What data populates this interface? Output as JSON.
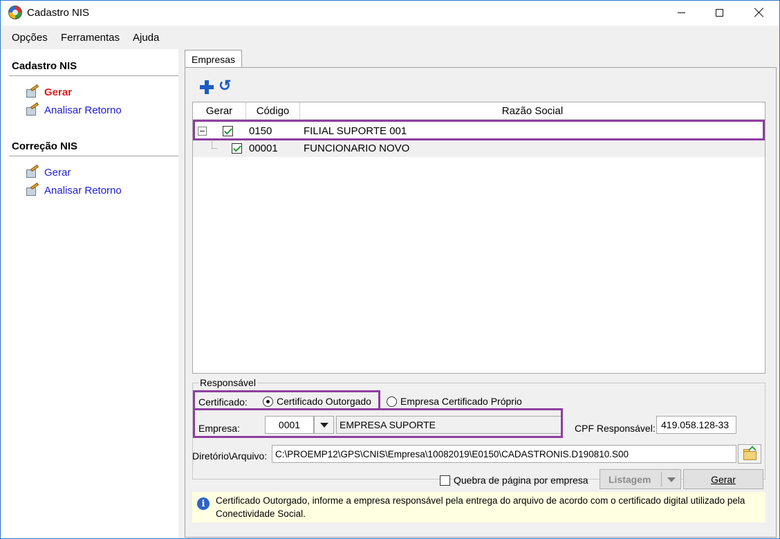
{
  "window": {
    "title": "Cadastro NIS"
  },
  "menu": {
    "items": [
      "Opções",
      "Ferramentas",
      "Ajuda"
    ]
  },
  "sidebar": {
    "sections": [
      {
        "title": "Cadastro NIS",
        "links": [
          {
            "label": "Gerar",
            "active": true
          },
          {
            "label": "Analisar Retorno",
            "active": false
          }
        ]
      },
      {
        "title": "Correção NIS",
        "links": [
          {
            "label": "Gerar",
            "active": false
          },
          {
            "label": "Analisar Retorno",
            "active": false
          }
        ]
      }
    ]
  },
  "tabs": [
    "Empresas"
  ],
  "grid": {
    "columns": [
      "Gerar",
      "Código",
      "Razão Social"
    ],
    "rows": [
      {
        "code": "0150",
        "name": "FILIAL SUPORTE 001",
        "checked": true,
        "expanded": true
      },
      {
        "code": "00001",
        "name": "FUNCIONARIO NOVO",
        "checked": true
      }
    ]
  },
  "responsavel": {
    "group_title": "Responsável",
    "certificado_label": "Certificado:",
    "option_outorgado": "Certificado Outorgado",
    "option_proprio": "Empresa Certificado Próprio",
    "empresa_label": "Empresa:",
    "empresa_code": "0001",
    "empresa_name": "EMPRESA SUPORTE",
    "cpf_label": "CPF Responsável:",
    "cpf_value": "419.058.128-33"
  },
  "diretorio": {
    "label": "Diretório\\Arquivo:",
    "path": "C:\\PROEMP12\\GPS\\CNIS\\Empresa\\10082019\\E0150\\CADASTRONIS.D190810.S00"
  },
  "actions": {
    "quebra_label": "Quebra de página por empresa",
    "listagem_label": "Listagem",
    "gerar_label": "Gerar"
  },
  "info": {
    "text": "Certificado Outorgado, informe a empresa responsável pela entrega do arquivo de acordo com o certificado digital utilizado pela Conectividade Social."
  },
  "colors": {
    "highlight": "#8e3ea0",
    "link": "#1d1dd6",
    "active_link": "#e21b1b",
    "info_background": "#ffffe1"
  }
}
